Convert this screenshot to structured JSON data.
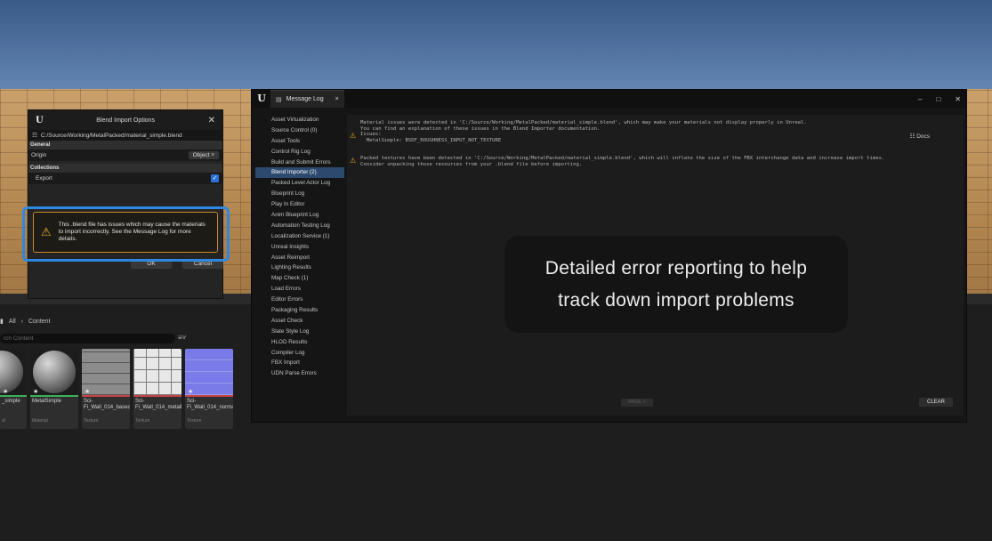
{
  "blend_dialog": {
    "title": "Blend Import Options",
    "path": "C:/Source/Working/MetalPacked/material_simple.blend",
    "section_general": "General",
    "origin_label": "Origin",
    "origin_value": "Object",
    "section_collections": "Collections",
    "export_label": "Export",
    "warning": "This .blend file has issues which may cause the materials to import incorrectly. See the Message Log for more details.",
    "ok_label": "OK",
    "cancel_label": "Cancel"
  },
  "content_browser": {
    "path_root": "All",
    "path_folder": "Content",
    "search_placeholder": "rch Content",
    "assets": [
      {
        "name": "_simple",
        "type": "al",
        "style": "sphereDark"
      },
      {
        "name": "MetalSimple",
        "type": "Material",
        "style": "sphere"
      },
      {
        "name": "Sci-Fi_Wall_014_basecolor",
        "type": "Texture",
        "style": "panelA"
      },
      {
        "name": "Sci-Fi_Wall_014_metallic",
        "type": "Texture",
        "style": "panelB"
      },
      {
        "name": "Sci-Fi_Wall_014_normal",
        "type": "Texture",
        "style": "panelC"
      }
    ]
  },
  "message_log": {
    "tab_label": "Message Log",
    "categories": [
      "Asset Virtualization",
      "Source Control (0)",
      "Asset Tools",
      "Control Rig Log",
      "Build and Submit Errors",
      "Blend Importer (2)",
      "Packed Level Actor Log",
      "Blueprint Log",
      "Play In Editor",
      "Anim Blueprint Log",
      "Automation Testing Log",
      "Localization Service (1)",
      "Unreal Insights",
      "Asset Reimport",
      "Lighting Results",
      "Map Check (1)",
      "Load Errors",
      "Editor Errors",
      "Packaging Results",
      "Asset Check",
      "Slate Style Log",
      "HLOD Results",
      "Compiler Log",
      "FBX Import",
      "UDN Parse Errors"
    ],
    "active_category": "Blend Importer (2)",
    "messages": [
      {
        "lines": "Material issues were detected in 'C:/Source/Working/MetalPacked/material_simple.blend', which may make your materials not display properly in Unreal.\nYou can find an explanation of these issues in the Blend Importer documentation.\nIssues:\n  MetalSimple: BSDF_ROUGHNESS_INPUT_NOT_TEXTURE"
      },
      {
        "lines": "Packed textures have been detected in 'C:/Source/Working/MetalPacked/material_simple.blend', which will inflate the size of the FBX interchange data and increase import times.\nConsider unpacking those resources from your .blend file before importing."
      }
    ],
    "docs_label": "Docs",
    "page_label": "PAGE",
    "clear_label": "CLEAR"
  },
  "caption": {
    "line1": "Detailed error reporting to help",
    "line2": "track down import problems"
  },
  "colors": {
    "accent_blue": "#2f88e0",
    "warning_amber": "#e5a82a",
    "active_row": "#2c4a6e"
  }
}
